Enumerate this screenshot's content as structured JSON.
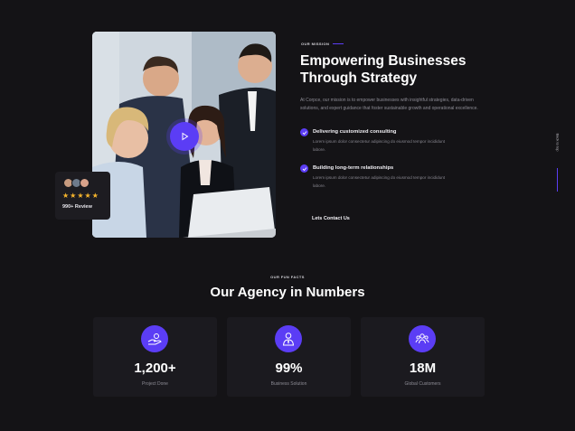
{
  "hero": {
    "review_label": "990+ Review",
    "stars": [
      "★",
      "★",
      "★",
      "★",
      "★"
    ]
  },
  "mission": {
    "tag": "OUR MISSION",
    "headline": "Empowering Businesses Through Strategy",
    "intro": "At Corpce, our mission is to empower businesses with insightful strategies, data-driven solutions, and expert guidance that foster sustainable growth and operational excellence.",
    "features": [
      {
        "title": "Delivering customized consulting",
        "desc": "Lorem ipsum dolor consectetur adipiscing do eiusmod tempor incididunt labore."
      },
      {
        "title": "Building long-term relationships",
        "desc": "Lorem ipsum dolor consectetur adipiscing do eiusmod tempor incididunt labore."
      }
    ],
    "cta": "Lets Contact Us"
  },
  "scroll_top_label": "Back to top",
  "facts": {
    "tag": "OUR FUN FACTS",
    "title": "Our Agency in Numbers",
    "cards": [
      {
        "icon": "hand-coins-icon",
        "value": "1,200+",
        "label": "Project Done"
      },
      {
        "icon": "businessman-icon",
        "value": "99%",
        "label": "Business Solution"
      },
      {
        "icon": "team-icon",
        "value": "18M",
        "label": "Global Customers"
      }
    ]
  },
  "colors": {
    "background": "#141316",
    "accent": "#5b3df5",
    "card": "#1b1a1f",
    "star": "#f7b52c",
    "muted_text": "#8d8c95"
  }
}
